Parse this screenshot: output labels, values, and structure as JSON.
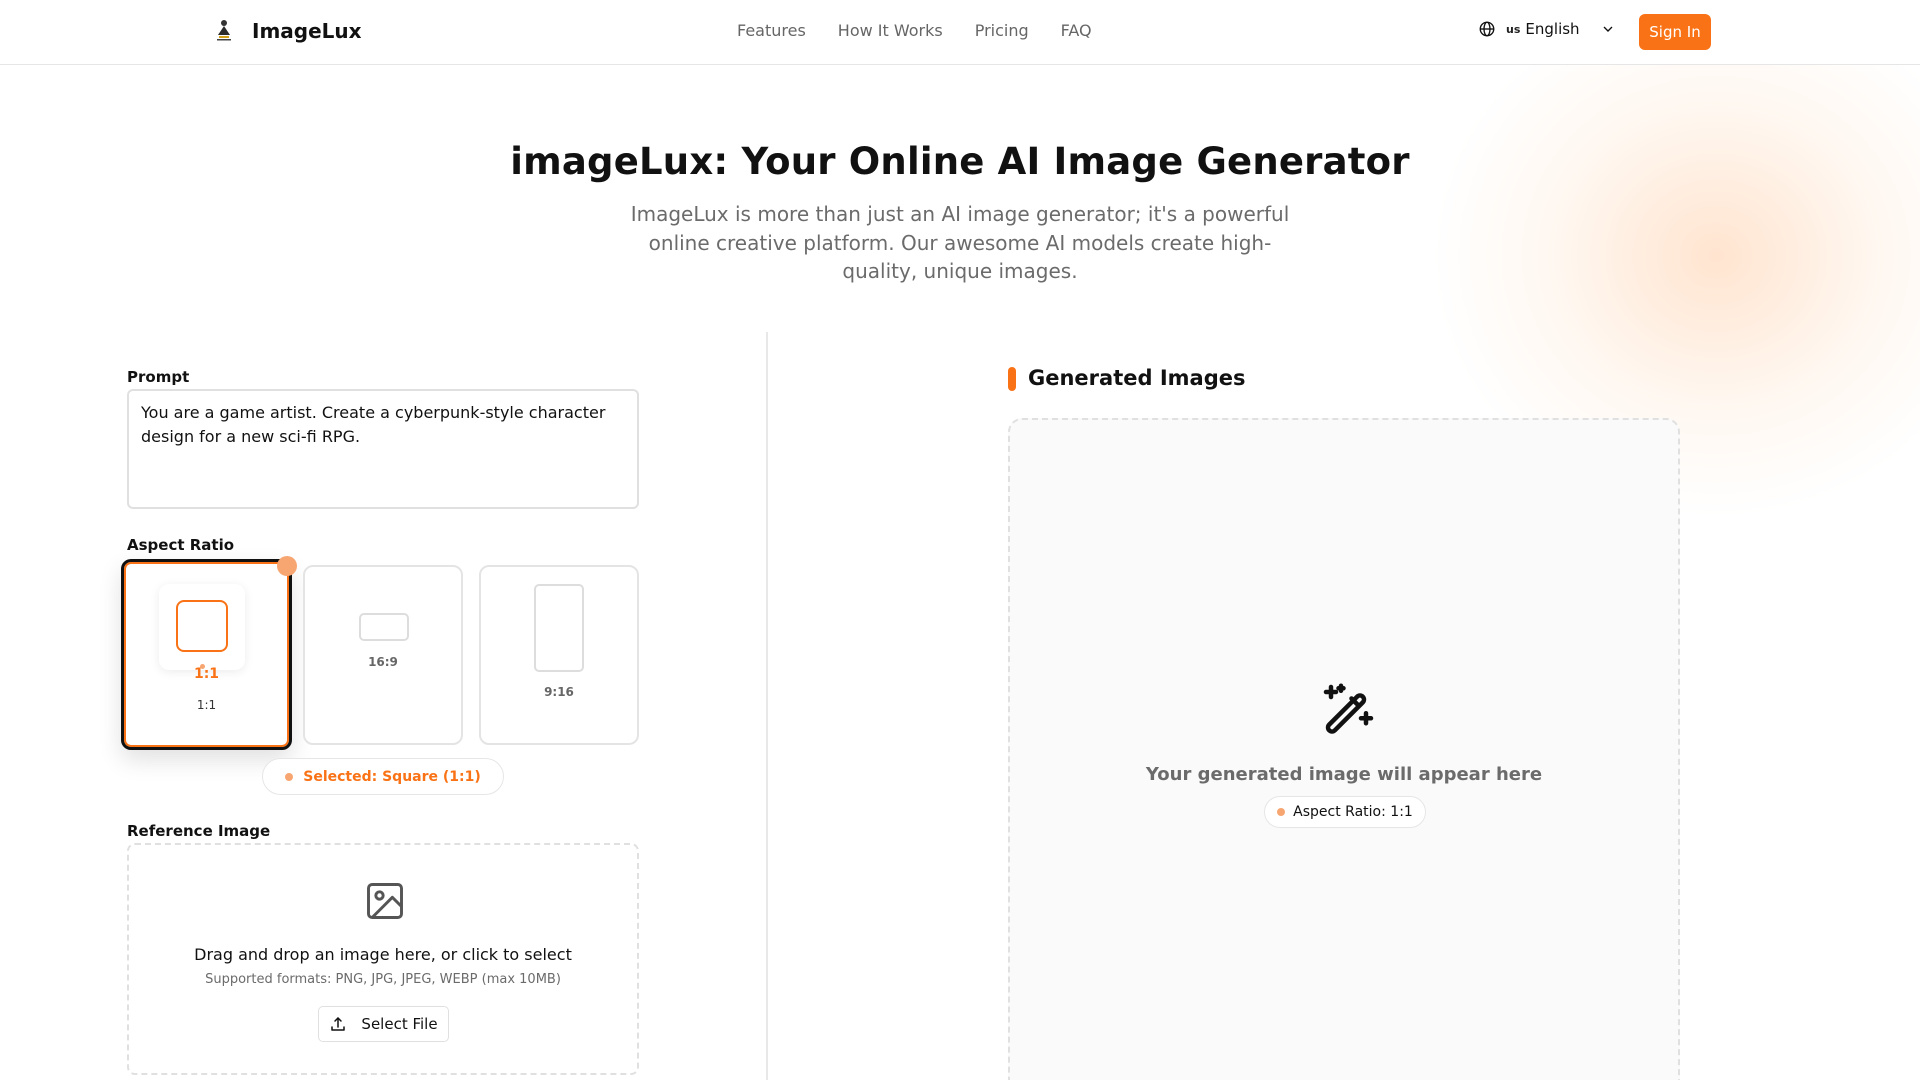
{
  "header": {
    "brand": "ImageLux",
    "nav": [
      "Features",
      "How It Works",
      "Pricing",
      "FAQ"
    ],
    "language": {
      "flag": "us",
      "label": "English"
    },
    "sign_in": "Sign In"
  },
  "hero": {
    "title": "imageLux: Your Online AI Image Generator",
    "subtitle": "ImageLux is more than just an AI image generator; it's a powerful online creative platform. Our awesome AI models create high-quality, unique images."
  },
  "form": {
    "prompt_label": "Prompt",
    "prompt_value": "You are a game artist. Create a cyberpunk-style character design for a new sci-fi RPG.",
    "aspect_label": "Aspect Ratio",
    "ratios": [
      {
        "ratio": "1:1",
        "caption": "1:1",
        "selected": true
      },
      {
        "ratio": "16:9",
        "selected": false
      },
      {
        "ratio": "9:16",
        "selected": false
      }
    ],
    "selected_text": "Selected: Square (1:1)",
    "reference_label": "Reference Image",
    "drop_text": "Drag and drop an image here, or click to select",
    "formats_text": "Supported formats: PNG, JPG, JPEG, WEBP (max 10MB)",
    "select_file": "Select File"
  },
  "output": {
    "title": "Generated Images",
    "placeholder": "Your generated image will appear here",
    "aspect_badge": "Aspect Ratio: 1:1"
  },
  "colors": {
    "accent": "#f97316",
    "accent_soft": "#f7a672",
    "text_muted": "#6b6b6b",
    "border": "#e0e0e0"
  },
  "icons": [
    "logo-icon",
    "globe-icon",
    "chevron-down-icon",
    "image-icon",
    "upload-icon",
    "magic-wand-icon"
  ]
}
